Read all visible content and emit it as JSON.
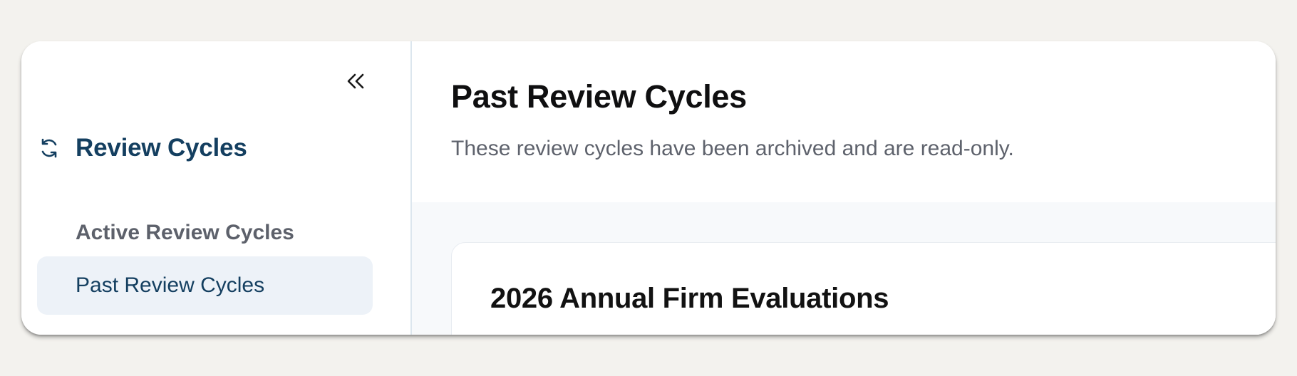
{
  "sidebar": {
    "collapse_icon": "double-chevron-left-icon",
    "section": {
      "icon": "refresh-cycle-icon",
      "title": "Review Cycles"
    },
    "items": [
      {
        "label": "Active Review Cycles",
        "active": false
      },
      {
        "label": "Past Review Cycles",
        "active": true
      }
    ]
  },
  "main": {
    "title": "Past Review Cycles",
    "subtitle": "These review cycles have been archived and are read-only.",
    "cards": [
      {
        "title": "2026 Annual Firm Evaluations"
      }
    ]
  },
  "colors": {
    "page_background": "#f3f2ee",
    "accent_navy": "#143f60",
    "active_item_background": "#edf2f8",
    "muted_text": "#5e626c",
    "content_background": "#f7f9fb"
  }
}
